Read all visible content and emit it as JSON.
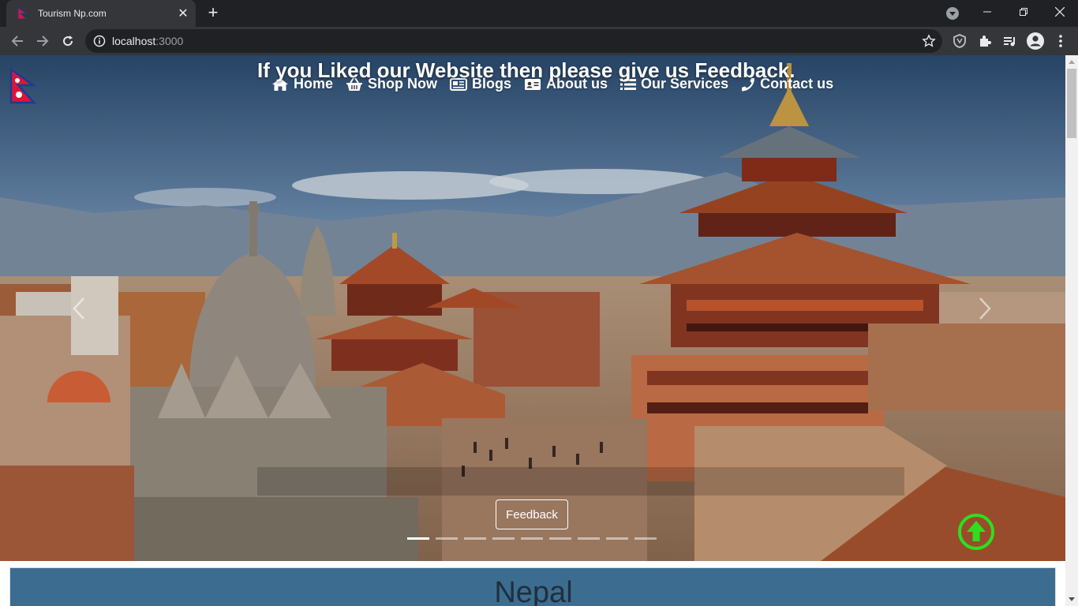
{
  "browser": {
    "tab_title": "Tourism Np.com",
    "url_host": "localhost",
    "url_port": ":3000"
  },
  "nav": {
    "items": [
      {
        "label": "Home",
        "icon": "home-icon"
      },
      {
        "label": "Shop Now",
        "icon": "basket-icon"
      },
      {
        "label": "Blogs",
        "icon": "newspaper-icon"
      },
      {
        "label": "About us",
        "icon": "id-card-icon"
      },
      {
        "label": "Our Services",
        "icon": "list-icon"
      },
      {
        "label": "Contact us",
        "icon": "phone-icon"
      }
    ]
  },
  "hero": {
    "caption": "If you Liked our Website then please give us Feedback.",
    "feedback_label": "Feedback",
    "slide_count": 9,
    "active_slide": 0
  },
  "content": {
    "title": "Nepal"
  },
  "colors": {
    "to_top": "#2be01f",
    "accent_blue": "#3c6d90"
  }
}
